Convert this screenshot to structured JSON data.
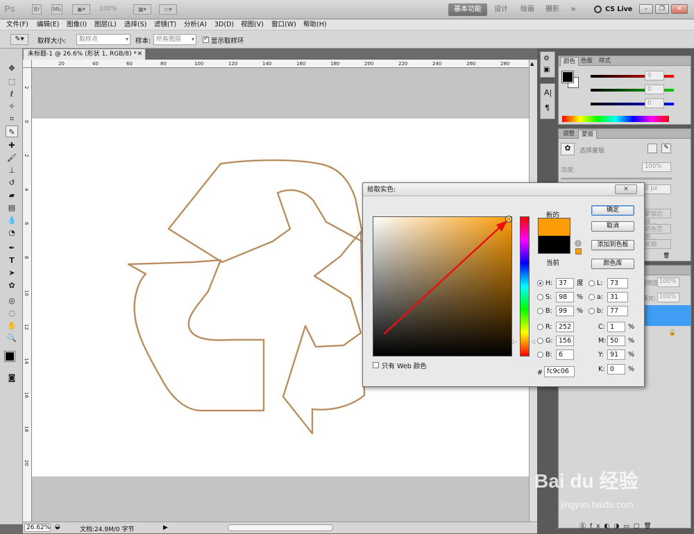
{
  "app": {
    "logo": "Ps",
    "zoom_preset": "100%"
  },
  "workspace": {
    "items": [
      "基本功能",
      "设计",
      "绘画",
      "摄影"
    ],
    "more": "»",
    "cslive": "CS Live"
  },
  "menu": [
    "文件(F)",
    "编辑(E)",
    "图像(I)",
    "图层(L)",
    "选择(S)",
    "滤镜(T)",
    "分析(A)",
    "3D(D)",
    "视图(V)",
    "窗口(W)",
    "帮助(H)"
  ],
  "options": {
    "sample_size_label": "取样大小:",
    "sample_size_value": "取样点",
    "sample_label": "样本:",
    "sample_value": "所有图层",
    "show_ring_label": "显示取样环"
  },
  "document": {
    "tab_title": "未标题-1 @ 26.6% (形状 1, RGB/8) *"
  },
  "ruler_h": [
    "20",
    "40",
    "60",
    "80",
    "100",
    "120",
    "140",
    "160",
    "180",
    "200",
    "220",
    "240",
    "260",
    "280"
  ],
  "ruler_v": [
    "2",
    "0",
    "2",
    "4",
    "6",
    "8",
    "10",
    "12",
    "14",
    "16",
    "18",
    "20"
  ],
  "status": {
    "zoom": "26.62%",
    "doc": "文档:24.9M/0 字节"
  },
  "panels": {
    "color_tabs": [
      "颜色",
      "色板",
      "样式"
    ],
    "color_values": [
      "0",
      "0",
      "0"
    ],
    "adjust_tabs": [
      "调整",
      "蒙版"
    ],
    "mask_label": "选择蒙版",
    "density_label": "浓度:",
    "density_value": "100%",
    "feather_value": "0 px",
    "mask_edge": "蒙版边缘...",
    "color_range": "颜色范围...",
    "invert": "反相",
    "opacity_label": "不透明度:",
    "opacity_value": "100%",
    "fill_label": "填充:",
    "fill_value": "100%"
  },
  "dialog": {
    "title": "拾取实色:",
    "close": "✕",
    "new_label": "新的",
    "current_label": "当前",
    "new_color": "#fc9c06",
    "current_color": "#000000",
    "ok": "确定",
    "cancel": "取消",
    "add_swatch": "添加到色板",
    "libraries": "颜色库",
    "web_only": "只有 Web 颜色",
    "hash": "#",
    "hex": "fc9c06",
    "fields_left": [
      {
        "label": "H:",
        "value": "37",
        "unit": "度",
        "checked": true
      },
      {
        "label": "S:",
        "value": "98",
        "unit": "%",
        "checked": false
      },
      {
        "label": "B:",
        "value": "99",
        "unit": "%",
        "checked": false
      },
      {
        "label": "R:",
        "value": "252",
        "unit": "",
        "checked": false
      },
      {
        "label": "G:",
        "value": "156",
        "unit": "",
        "checked": false
      },
      {
        "label": "B:",
        "value": "6",
        "unit": "",
        "checked": false
      }
    ],
    "fields_lab": [
      {
        "label": "L:",
        "value": "73"
      },
      {
        "label": "a:",
        "value": "31"
      },
      {
        "label": "b:",
        "value": "77"
      }
    ],
    "fields_cmyk": [
      {
        "label": "C:",
        "value": "1",
        "unit": "%"
      },
      {
        "label": "M:",
        "value": "50",
        "unit": "%"
      },
      {
        "label": "Y:",
        "value": "91",
        "unit": "%"
      },
      {
        "label": "K:",
        "value": "0",
        "unit": "%"
      }
    ]
  },
  "watermark": {
    "brand": "Bai du 经验",
    "url": "jingyan.baidu.com"
  }
}
